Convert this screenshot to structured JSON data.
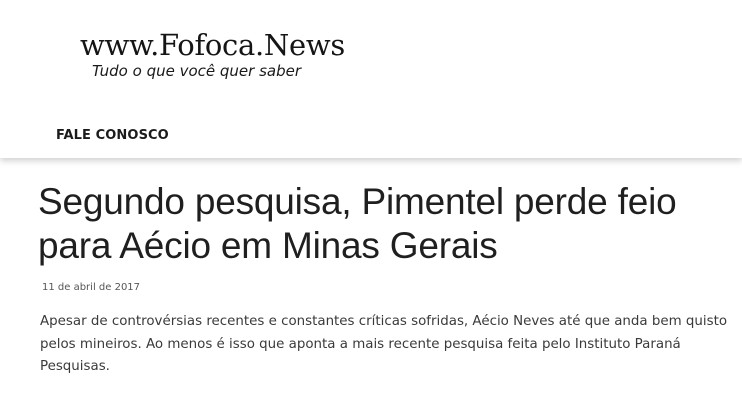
{
  "site": {
    "logo_title": "www.Fofoca.News",
    "logo_tagline": "Tudo o que você quer saber"
  },
  "nav": {
    "items": [
      {
        "label": "FALE CONOSCO"
      }
    ]
  },
  "article": {
    "title": "Segundo pesquisa, Pimentel perde feio para Aécio em Minas Gerais",
    "date": "11 de abril de 2017",
    "excerpt": "Apesar de controvérsias recentes e constantes críticas sofridas, Aécio Neves até que anda bem quisto pelos mineiros. Ao menos é isso que aponta a mais recente pesquisa feita pelo Instituto Paraná Pesquisas."
  }
}
